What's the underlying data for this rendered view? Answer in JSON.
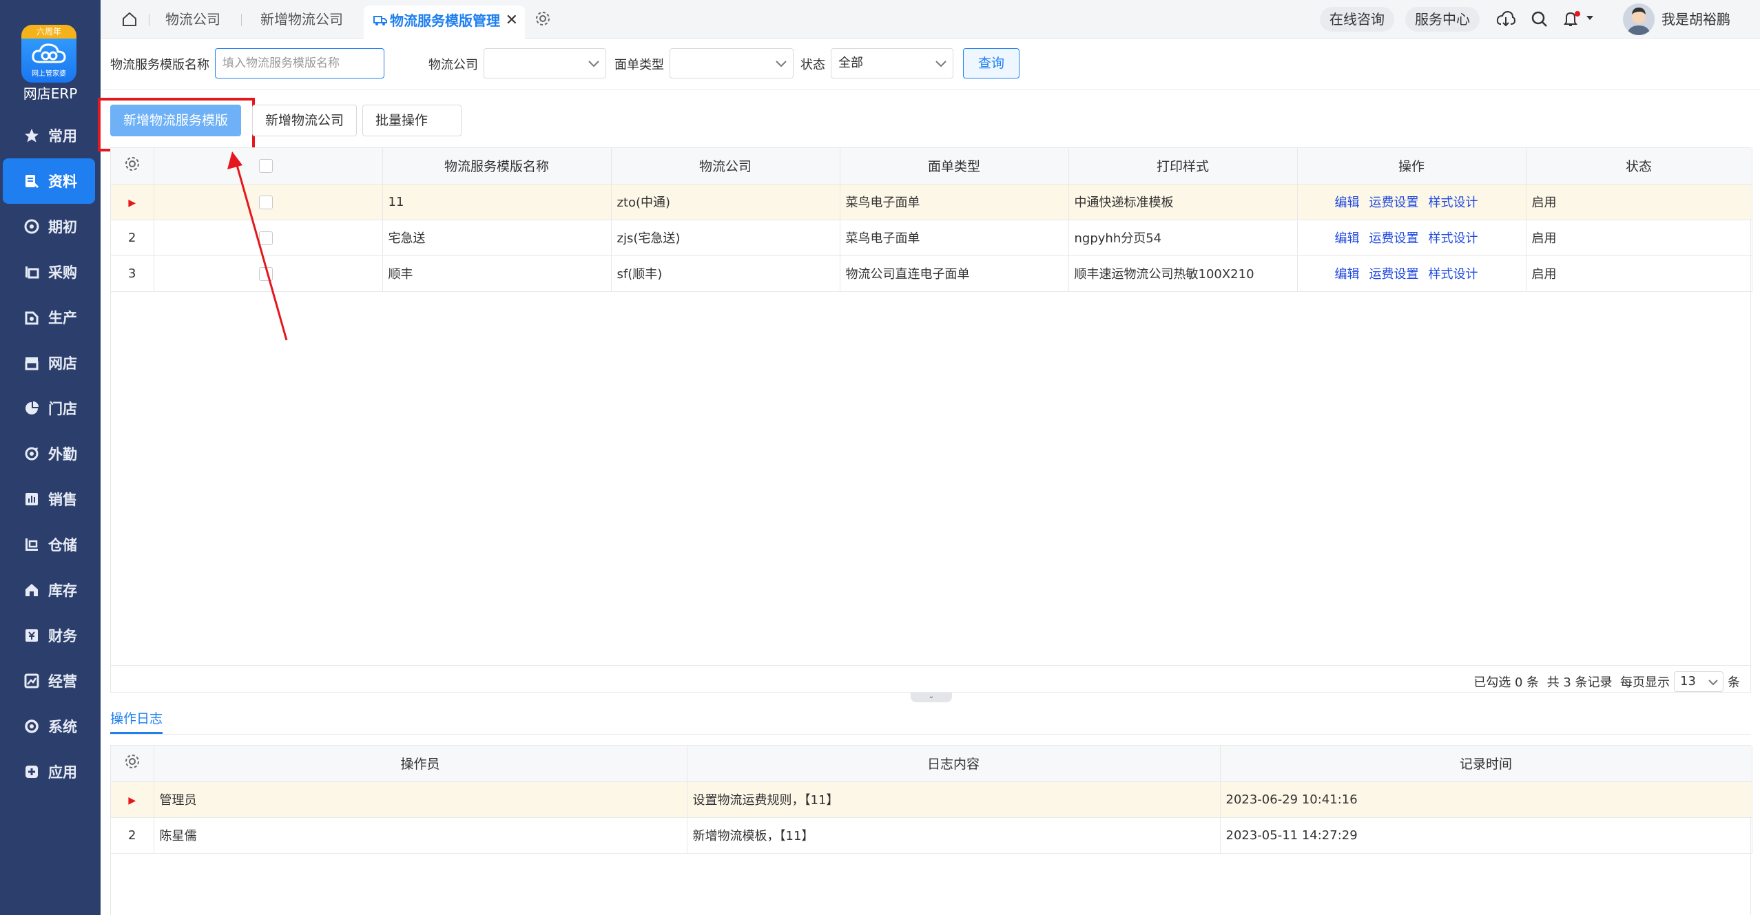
{
  "sidebar": {
    "logo_badge": "六周年",
    "logo_text": "网上管家婆",
    "app_name": "网店ERP",
    "items": [
      {
        "label": "常用",
        "icon": "star-icon"
      },
      {
        "label": "资料",
        "icon": "document-icon",
        "active": true
      },
      {
        "label": "期初",
        "icon": "target-icon"
      },
      {
        "label": "采购",
        "icon": "purchase-icon"
      },
      {
        "label": "生产",
        "icon": "factory-icon"
      },
      {
        "label": "网店",
        "icon": "shop-icon"
      },
      {
        "label": "门店",
        "icon": "pie-icon"
      },
      {
        "label": "外勤",
        "icon": "field-icon"
      },
      {
        "label": "销售",
        "icon": "sales-icon"
      },
      {
        "label": "仓储",
        "icon": "warehouse-icon"
      },
      {
        "label": "库存",
        "icon": "stock-icon"
      },
      {
        "label": "财务",
        "icon": "finance-icon"
      },
      {
        "label": "经营",
        "icon": "operate-icon"
      },
      {
        "label": "系统",
        "icon": "system-icon"
      },
      {
        "label": "应用",
        "icon": "plus-icon"
      }
    ]
  },
  "topbar": {
    "tabs": [
      "物流公司",
      "新增物流公司"
    ],
    "active_tab": "物流服务模版管理",
    "consult": "在线咨询",
    "service": "服务中心",
    "username": "我是胡裕鹏"
  },
  "filter": {
    "name_label": "物流服务模版名称",
    "name_placeholder": "填入物流服务模版名称",
    "company_label": "物流公司",
    "company_value": "",
    "type_label": "面单类型",
    "type_value": "",
    "status_label": "状态",
    "status_value": "全部",
    "query_label": "查询"
  },
  "toolbar": {
    "add_template": "新增物流服务模版",
    "add_company": "新增物流公司",
    "batch": "批量操作"
  },
  "table": {
    "columns": [
      "物流服务模版名称",
      "物流公司",
      "面单类型",
      "打印样式",
      "操作",
      "状态"
    ],
    "ops": [
      "编辑",
      "运费设置",
      "样式设计"
    ],
    "rows": [
      {
        "no": "",
        "name": "11",
        "company": "zto(中通)",
        "type": "菜鸟电子面单",
        "style": "中通快递标准模板",
        "status": "启用"
      },
      {
        "no": "2",
        "name": "宅急送",
        "company": "zjs(宅急送)",
        "type": "菜鸟电子面单",
        "style": "ngpyhh分页54",
        "status": "启用"
      },
      {
        "no": "3",
        "name": "顺丰",
        "company": "sf(顺丰)",
        "type": "物流公司直连电子面单",
        "style": "顺丰速运物流公司热敏100X210",
        "status": "启用"
      }
    ]
  },
  "pager": {
    "selected": "已勾选 0 条",
    "total": "共 3 条记录",
    "per_page_label": "每页显示",
    "per_page": "13",
    "unit": "条"
  },
  "log": {
    "tab": "操作日志",
    "columns": [
      "操作员",
      "日志内容",
      "记录时间"
    ],
    "rows": [
      {
        "no": "",
        "operator": "管理员",
        "content": "设置物流运费规则，【11】",
        "time": "2023-06-29 10:41:16"
      },
      {
        "no": "2",
        "operator": "陈星儒",
        "content": "新增物流模板，【11】",
        "time": "2023-05-11 14:27:29"
      }
    ]
  },
  "colors": {
    "sidebar": "#2c3e6b",
    "accent": "#1f7ff0",
    "highlight": "#e5161d"
  }
}
